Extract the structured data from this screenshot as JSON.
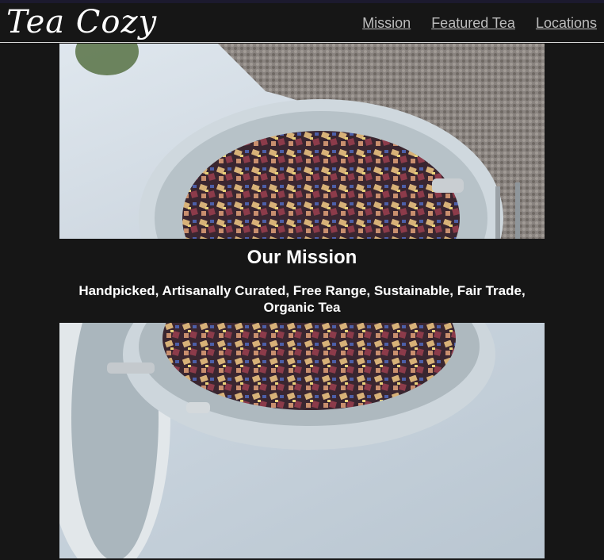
{
  "header": {
    "logo": "Tea Cozy",
    "nav": [
      {
        "label": "Mission"
      },
      {
        "label": "Featured Tea"
      },
      {
        "label": "Locations"
      }
    ]
  },
  "mission": {
    "title": "Our Mission",
    "tagline": "Handpicked, Artisanally Curated, Free Range, Sustainable, Fair Trade, Organic Tea"
  },
  "colors": {
    "background": "#161616",
    "text": "#ffffff",
    "nav_link": "#bdbdbd",
    "header_border": "#d8d8d8"
  }
}
